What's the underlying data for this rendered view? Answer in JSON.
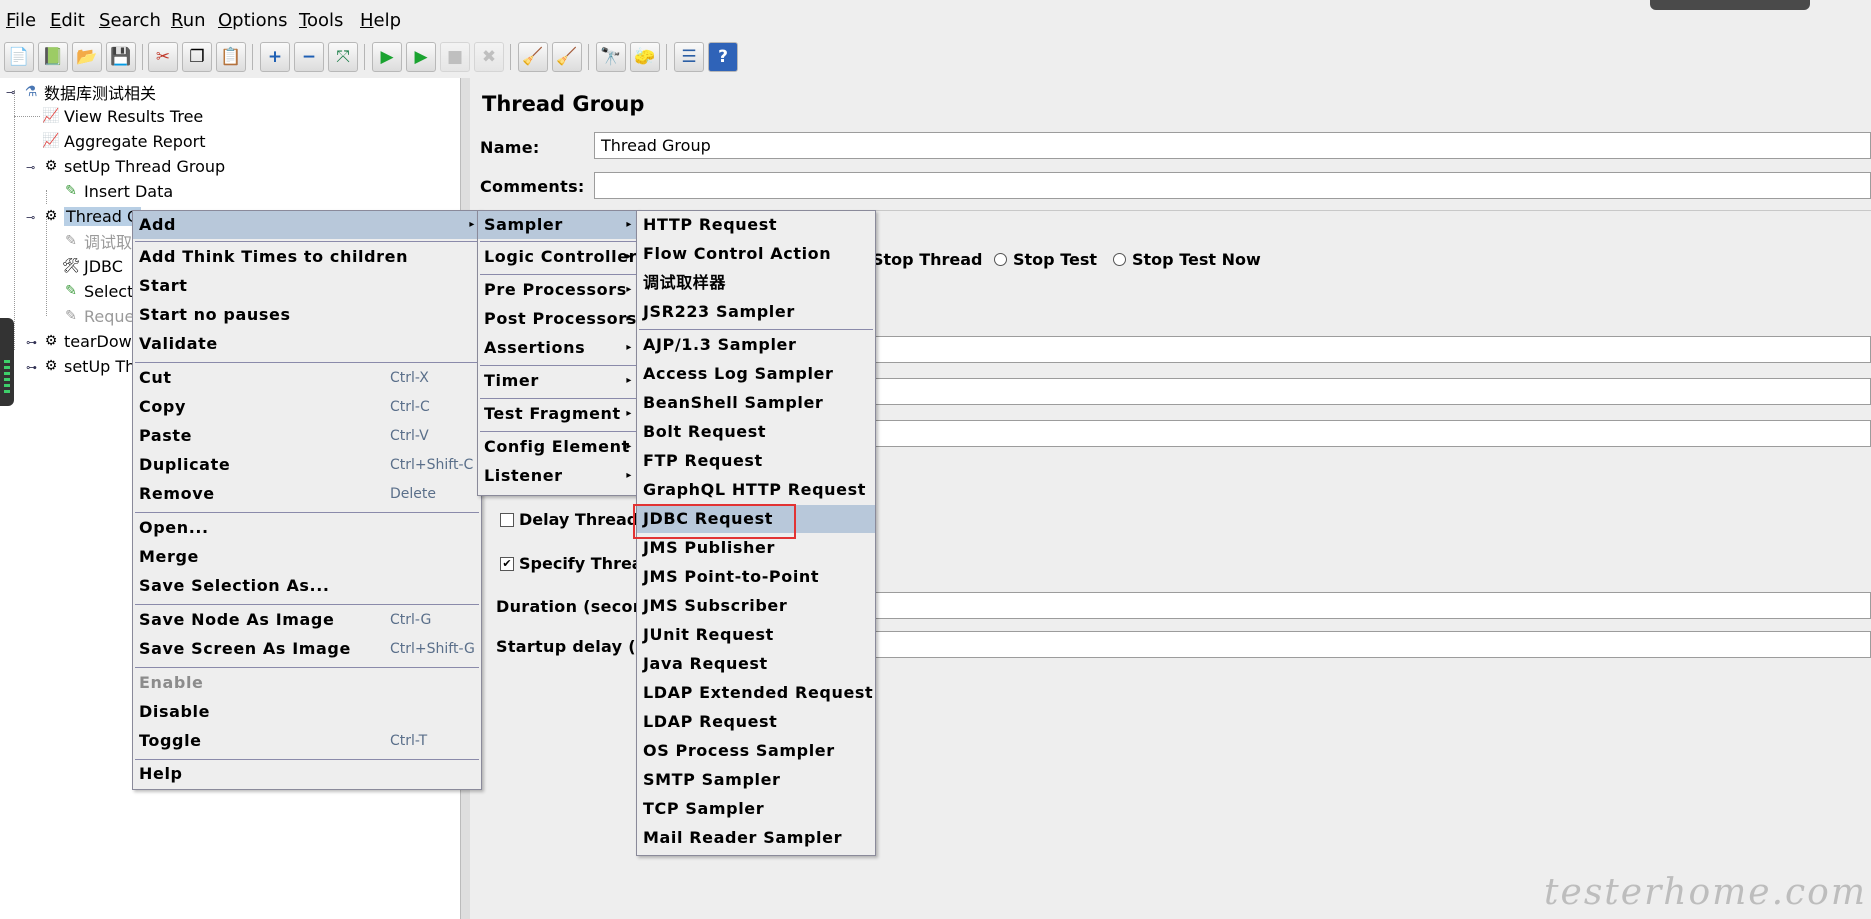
{
  "menubar": [
    {
      "u": "F",
      "rest": "ile"
    },
    {
      "u": "E",
      "rest": "dit"
    },
    {
      "u": "S",
      "rest": "earch"
    },
    {
      "u": "R",
      "rest": "un"
    },
    {
      "u": "O",
      "rest": "ptions"
    },
    {
      "u": "T",
      "rest": "ools"
    },
    {
      "u": "H",
      "rest": "elp"
    }
  ],
  "toolbar": {
    "new_icon": "📄",
    "templates_icon": "📗",
    "open_icon": "📂",
    "save_icon": "💾",
    "cut_icon": "✂",
    "copy_icon": "❐",
    "paste_icon": "📋",
    "expand_icon": "+",
    "collapse_icon": "−",
    "toggle_icon": "⤧",
    "start_icon": "▶",
    "start_no_pause_icon": "▶",
    "stop_icon": "■",
    "shutdown_icon": "✖",
    "clear_icon": "🧹",
    "clear_all_icon": "🧹",
    "search_icon": "🔭",
    "reset_search_icon": "🧽",
    "function_helper_icon": "☰",
    "help_icon": "?"
  },
  "tree": {
    "root": "数据库测试相关",
    "items": [
      "View Results Tree",
      "Aggregate Report",
      "setUp Thread Group",
      "Insert Data",
      "Thread G",
      "调试取",
      "JDBC",
      "Select",
      "Reque",
      "tearDow",
      "setUp Th"
    ]
  },
  "panel": {
    "title": "Thread Group",
    "name_label": "Name:",
    "name_value": "Thread Group",
    "comments_label": "Comments:",
    "radio_stop_thread": "Stop Thread",
    "radio_stop_test": "Stop Test",
    "radio_stop_test_now": "Stop Test Now",
    "delay_label": "Delay Thread",
    "specify_label": "Specify Threa",
    "duration_label": "Duration (secon",
    "startup_label": "Startup delay (se"
  },
  "context_menu": {
    "add": "Add",
    "add_think": "Add Think Times to children",
    "start": "Start",
    "start_no_pauses": "Start no pauses",
    "validate": "Validate",
    "cut": "Cut",
    "cut_key": "Ctrl-X",
    "copy": "Copy",
    "copy_key": "Ctrl-C",
    "paste": "Paste",
    "paste_key": "Ctrl-V",
    "duplicate": "Duplicate",
    "duplicate_key": "Ctrl+Shift-C",
    "remove": "Remove",
    "remove_key": "Delete",
    "open": "Open...",
    "merge": "Merge",
    "save_selection": "Save Selection As...",
    "save_node_image": "Save Node As Image",
    "save_node_key": "Ctrl-G",
    "save_screen_image": "Save Screen As Image",
    "save_screen_key": "Ctrl+Shift-G",
    "enable": "Enable",
    "disable": "Disable",
    "toggle": "Toggle",
    "toggle_key": "Ctrl-T",
    "help": "Help"
  },
  "add_menu": {
    "sampler": "Sampler",
    "logic_controller": "Logic Controller",
    "pre_processors": "Pre Processors",
    "post_processors": "Post Processors",
    "assertions": "Assertions",
    "timer": "Timer",
    "test_fragment": "Test Fragment",
    "config_element": "Config Element",
    "listener": "Listener"
  },
  "sampler_menu": {
    "http": "HTTP Request",
    "flow_control": "Flow Control Action",
    "debug": "调试取样器",
    "jsr223": "JSR223 Sampler",
    "ajp": "AJP/1.3 Sampler",
    "access_log": "Access Log Sampler",
    "beanshell": "BeanShell Sampler",
    "bolt": "Bolt Request",
    "ftp": "FTP Request",
    "graphql": "GraphQL HTTP Request",
    "jdbc": "JDBC Request",
    "jms_publisher": "JMS Publisher",
    "jms_p2p": "JMS Point-to-Point",
    "jms_subscriber": "JMS Subscriber",
    "junit": "JUnit Request",
    "java": "Java Request",
    "ldap_ext": "LDAP Extended Request",
    "ldap": "LDAP Request",
    "os_process": "OS Process Sampler",
    "smtp": "SMTP Sampler",
    "tcp": "TCP Sampler",
    "mail_reader": "Mail Reader Sampler"
  },
  "watermark": "testerhome.com",
  "colors": {
    "highlight": "#b8c8da",
    "callout": "#e23333",
    "tree_selection": "#b8cfe5"
  }
}
